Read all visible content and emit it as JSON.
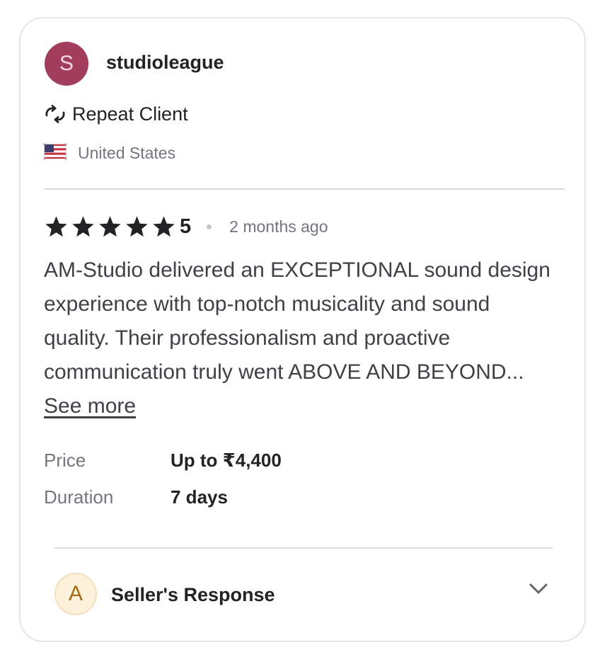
{
  "reviewer": {
    "avatar_initial": "S",
    "username": "studioleague",
    "repeat_label": "Repeat Client",
    "country": "United States"
  },
  "rating": {
    "stars": 5,
    "value": "5",
    "time_ago": "2 months ago"
  },
  "review": {
    "text": "AM-Studio delivered an EXCEPTIONAL sound design experience with top-notch musicality and sound quality. Their professionalism and proactive communication truly went ABOVE AND BEYOND...",
    "see_more": "See more"
  },
  "details": {
    "price_label": "Price",
    "price_value": "Up to ₹4,400",
    "duration_label": "Duration",
    "duration_value": "7 days"
  },
  "seller_response": {
    "avatar_initial": "A",
    "label": "Seller's Response"
  },
  "colors": {
    "reviewer_avatar": "#a23d5c",
    "seller_avatar_bg": "#fdf1dc",
    "seller_avatar_text": "#a36b12",
    "star": "#222325"
  },
  "icons": {
    "repeat": "repeat-icon",
    "flag": "us-flag-icon",
    "star": "star-icon",
    "expand": "chevron-down-icon"
  }
}
